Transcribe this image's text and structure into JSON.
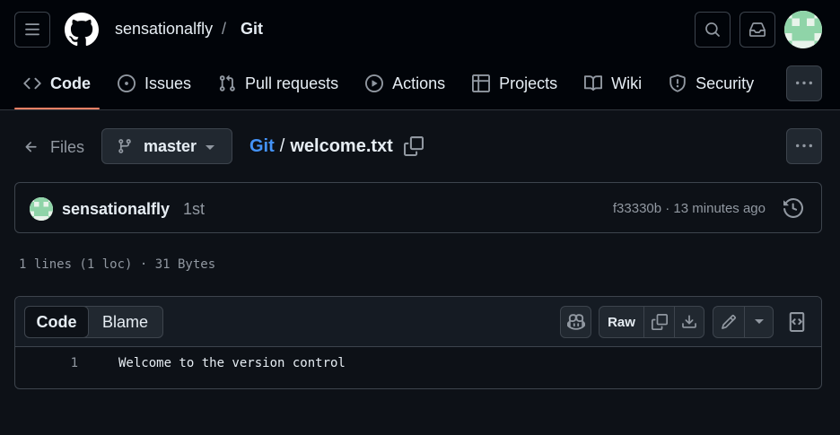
{
  "header": {
    "owner": "sensationalfly",
    "separator": "/",
    "repo": "Git",
    "icons": {
      "menu": "hamburger-icon",
      "logo": "github-logo-icon",
      "search": "search-icon",
      "inbox": "inbox-icon"
    }
  },
  "nav": {
    "tabs": [
      {
        "label": "Code",
        "icon": "code-icon",
        "active": true
      },
      {
        "label": "Issues",
        "icon": "issue-icon"
      },
      {
        "label": "Pull requests",
        "icon": "pull-request-icon"
      },
      {
        "label": "Actions",
        "icon": "play-icon"
      },
      {
        "label": "Projects",
        "icon": "table-icon"
      },
      {
        "label": "Wiki",
        "icon": "book-icon"
      },
      {
        "label": "Security",
        "icon": "shield-icon"
      }
    ]
  },
  "breadcrumb": {
    "files_label": "Files",
    "branch": "master",
    "repo_link": "Git",
    "separator": "/",
    "file_name": "welcome.txt"
  },
  "commit": {
    "author": "sensationalfly",
    "message": "1st",
    "sha_time": "f33330b · 13 minutes ago"
  },
  "file_stats": "1 lines (1 loc) · 31 Bytes",
  "file_view": {
    "view_tabs": [
      "Code",
      "Blame"
    ],
    "active_view": "Code",
    "raw_label": "Raw",
    "lines": [
      {
        "number": "1",
        "text": "Welcome to the version control"
      }
    ]
  },
  "colors": {
    "accent": "#f78166",
    "link": "#4493f8",
    "background": "#0d1117",
    "header_bg": "#010409"
  }
}
